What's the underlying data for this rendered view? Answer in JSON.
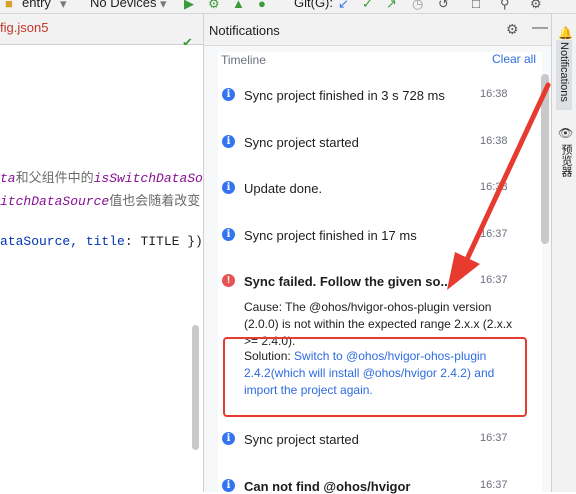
{
  "toolbar": {
    "config_label": "entry",
    "device_label": "No Devices",
    "git_label": "Git(G):"
  },
  "editor": {
    "tab_label": "fig.json5",
    "lines": [
      {
        "a": "ta",
        "b": "和父组件中的",
        "c": "isSwitchDataSo"
      },
      {
        "a": "itchDataSource",
        "b": "值也会随着改变"
      },
      {
        "a": "ataSource, ",
        "b": "title",
        "c": ": TITLE })"
      }
    ]
  },
  "panel": {
    "title": "Notifications",
    "timeline_label": "Timeline",
    "clear_all_label": "Clear all",
    "items": [
      {
        "text": "Sync project finished in 3 s 728 ms",
        "time": "16:38"
      },
      {
        "text": "Sync project started",
        "time": "16:38"
      },
      {
        "text": "Update done.",
        "time": "16:38"
      },
      {
        "text": "Sync project finished in 17 ms",
        "time": "16:37"
      },
      {
        "text": "Sync failed. Follow the given so...",
        "time": "16:37",
        "cause": "Cause: The @ohos/hvigor-ohos-plugin version (2.0.0) is not within the expected range 2.x.x (2.x.x >= 2.4.0).",
        "solution_label": "Solution: ",
        "solution_link": "Switch to @ohos/hvigor-ohos-plugin 2.4.2(which will install @ohos/hvigor 2.4.2) and import the project again."
      },
      {
        "text": "Sync project started",
        "time": "16:37"
      },
      {
        "text": "Can not find @ohos/hvigor",
        "time": "16:37"
      }
    ]
  },
  "right_strip": {
    "notifications_tab": "Notifications",
    "preview_tab": "预览器"
  },
  "colors": {
    "accent": "#2f6be0",
    "info": "#3574f0",
    "error": "#e55353",
    "annotation_red": "#e63b2e"
  }
}
